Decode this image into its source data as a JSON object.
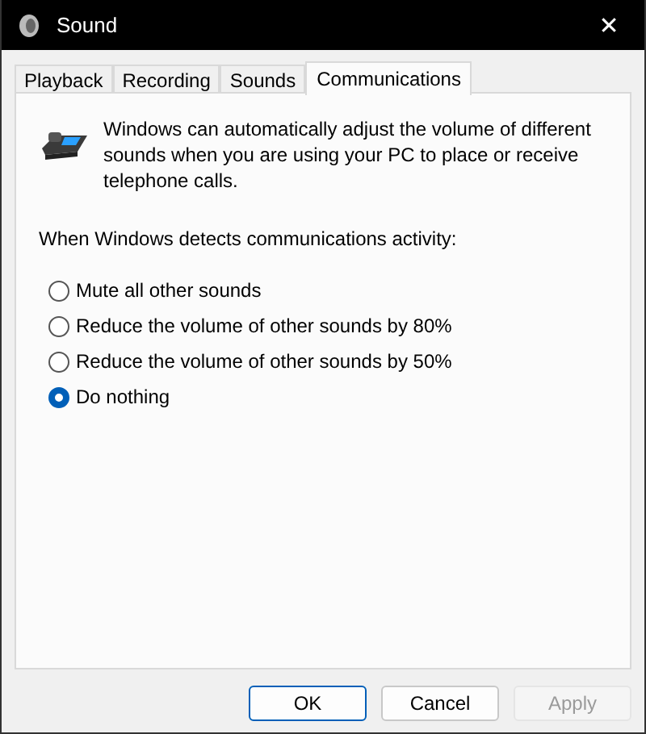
{
  "window": {
    "title": "Sound",
    "close": "✕"
  },
  "tabs": [
    {
      "label": "Playback",
      "selected": false
    },
    {
      "label": "Recording",
      "selected": false
    },
    {
      "label": "Sounds",
      "selected": false
    },
    {
      "label": "Communications",
      "selected": true
    }
  ],
  "intro": "Windows can automatically adjust the volume of different sounds when you are using your PC to place or receive telephone calls.",
  "prompt": "When Windows detects communications activity:",
  "options": [
    {
      "label": "Mute all other sounds",
      "selected": false
    },
    {
      "label": "Reduce the volume of other sounds by 80%",
      "selected": false
    },
    {
      "label": "Reduce the volume of other sounds by 50%",
      "selected": false
    },
    {
      "label": "Do nothing",
      "selected": true
    }
  ],
  "buttons": [
    {
      "label": "OK",
      "kind": "default",
      "disabled": false
    },
    {
      "label": "Cancel",
      "kind": "normal",
      "disabled": false
    },
    {
      "label": "Apply",
      "kind": "normal",
      "disabled": true
    }
  ]
}
